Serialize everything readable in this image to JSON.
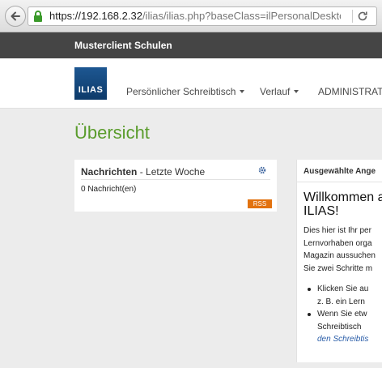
{
  "browser": {
    "url_host": "https://192.168.2.32",
    "url_path": "/ilias/ilias.php?baseClass=ilPersonalDesktc"
  },
  "top_bar": {
    "client_name": "Musterclient Schulen"
  },
  "nav": {
    "logo_text": "ILIAS",
    "items": [
      {
        "label": "Persönlicher Schreibtisch"
      },
      {
        "label": "Verlauf"
      },
      {
        "label": "ADMINISTRATIO"
      }
    ]
  },
  "page": {
    "title": "Übersicht"
  },
  "news": {
    "title": "Nachrichten",
    "subtitle": "- Letzte Woche",
    "count": "0 Nachricht(en)",
    "rss": "RSS"
  },
  "offers": {
    "header": "Ausgewählte Ange",
    "welcome_line1": "Willkommen a",
    "welcome_line2": "ILIAS!",
    "intro_lines": [
      "Dies hier ist Ihr per",
      "Lernvorhaben orga",
      "Magazin aussuchen",
      "Sie zwei Schritte m"
    ],
    "bullet1_line1": "Klicken Sie au",
    "bullet1_line2": "z. B. ein Lern",
    "bullet2_line1": "Wenn Sie etw",
    "bullet2_line2": "Schreibtisch",
    "bullet2_line3": "den Schreibtis"
  },
  "colors": {
    "accent_green": "#5a9c2c",
    "rss_orange": "#e2720f",
    "dark_bar": "#454545"
  }
}
